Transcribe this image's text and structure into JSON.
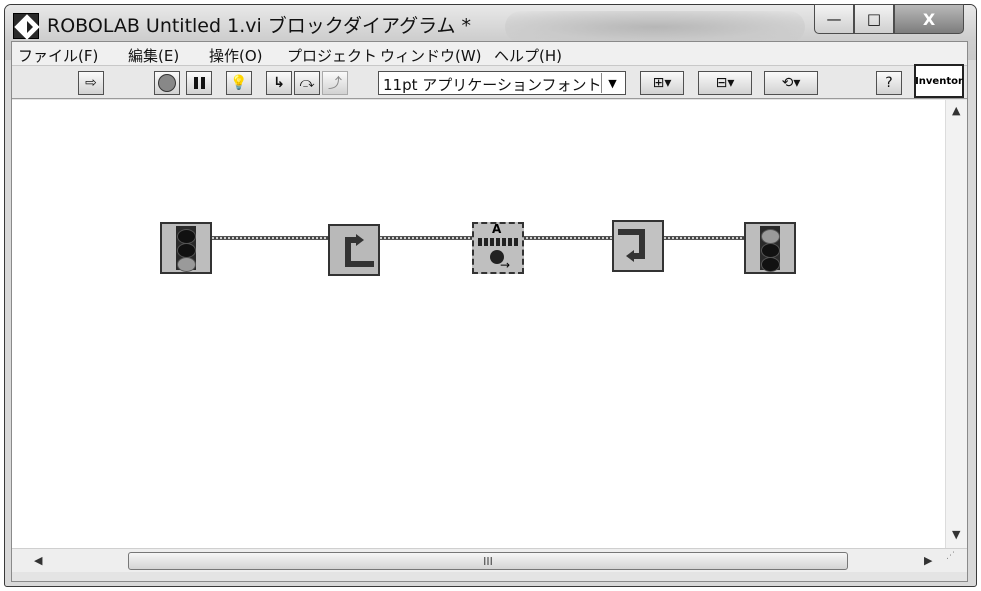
{
  "window": {
    "title": "ROBOLAB Untitled 1.vi ブロックダイアグラム *",
    "caption_minimize": "—",
    "caption_maximize": "□",
    "caption_close": "X"
  },
  "menubar": {
    "items": [
      "ファイル(F)",
      "編集(E)",
      "操作(O)",
      "プロジェクト",
      "ウィンドウ(W)",
      "ヘルプ(H)"
    ]
  },
  "toolbar": {
    "font_selector": "11pt アプリケーションフォント",
    "badge": "Inventor",
    "buttons": [
      "run-arrow-icon",
      "stop-icon",
      "pause-icon",
      "highlight-bulb-icon",
      "step-into-icon",
      "step-over-icon",
      "step-out-icon",
      "align-icon",
      "distribute-icon",
      "reorder-icon",
      "help-icon"
    ]
  },
  "scrollbar": {
    "thumb_grip": "III"
  },
  "diagram": {
    "nodes": [
      "begin-traffic-light-icon",
      "loop-start-icon",
      "motor-a-forward-icon",
      "loop-end-icon",
      "end-traffic-light-icon"
    ],
    "motor_port": "A"
  },
  "colors": {
    "canvas": "#ffffff",
    "chrome": "#d9d9d9",
    "node_fill": "#c8c8c8"
  }
}
